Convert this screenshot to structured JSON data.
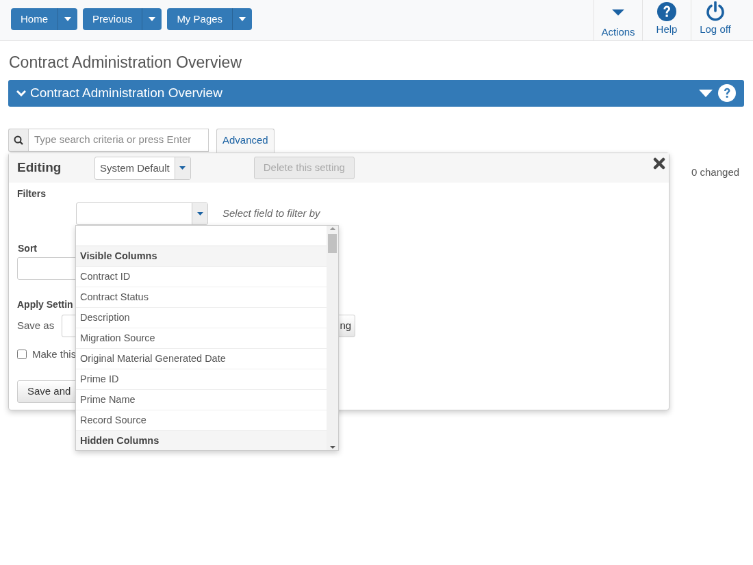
{
  "nav_buttons": [
    {
      "label": "Home"
    },
    {
      "label": "Previous"
    },
    {
      "label": "My Pages"
    }
  ],
  "nav_actions": [
    {
      "label": "Actions",
      "kind": "caret"
    },
    {
      "label": "Help",
      "kind": "help"
    },
    {
      "label": "Log off",
      "kind": "power"
    }
  ],
  "page_title": "Contract Administration Overview",
  "section_bar": {
    "title": "Contract Administration Overview",
    "expanded": true
  },
  "search": {
    "placeholder": "Type search criteria or press Enter"
  },
  "advanced_button": "Advanced",
  "changed_count": "0 changed",
  "editing_panel": {
    "title": "Editing",
    "setting_select": "System Default",
    "delete_button": {
      "label": "Delete this setting",
      "disabled": true
    },
    "filters_label": "Filters",
    "filter_hint": "Select field to filter by",
    "sort_label": "Sort",
    "apply_label": "Apply Settin",
    "save_as_label": "Save as",
    "save_setting_button": "ng",
    "default_checkbox": {
      "label": "Make this",
      "checked": false
    },
    "save_apply_button": "Save and"
  },
  "field_dropdown": {
    "options": [
      {
        "kind": "group",
        "label": "Visible Columns"
      },
      {
        "kind": "option",
        "label": "Contract ID"
      },
      {
        "kind": "option",
        "label": "Contract Status"
      },
      {
        "kind": "option",
        "label": "Description"
      },
      {
        "kind": "option",
        "label": "Migration Source"
      },
      {
        "kind": "option",
        "label": "Original Material Generated Date"
      },
      {
        "kind": "option",
        "label": "Prime ID"
      },
      {
        "kind": "option",
        "label": "Prime Name"
      },
      {
        "kind": "option",
        "label": "Record Source"
      },
      {
        "kind": "group",
        "label": "Hidden Columns"
      }
    ]
  }
}
